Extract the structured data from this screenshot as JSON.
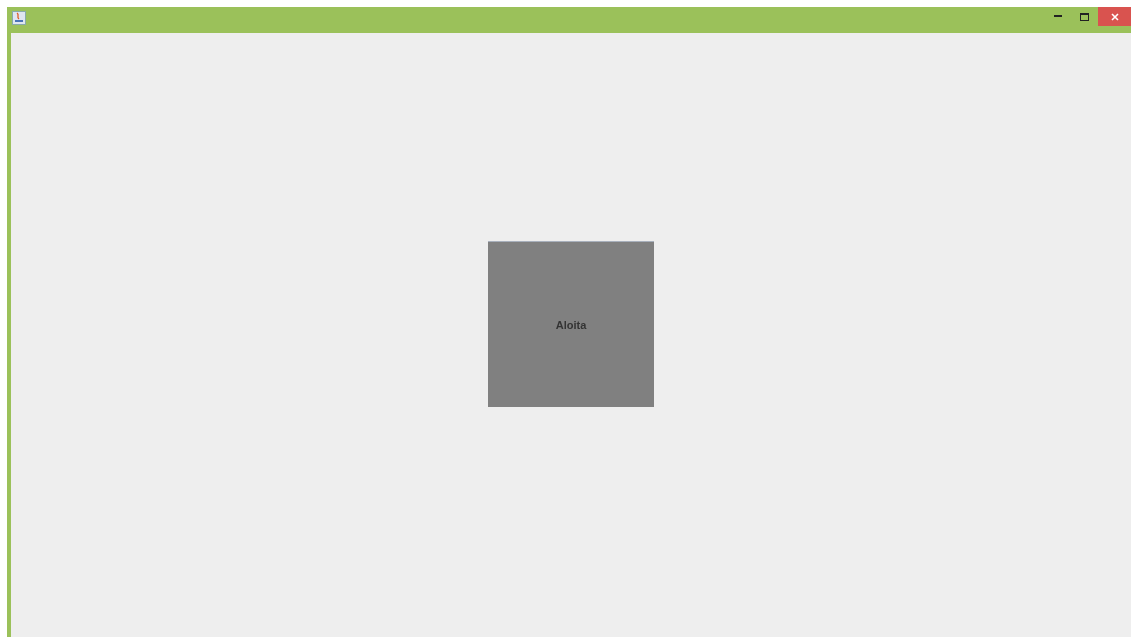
{
  "window": {
    "title_buttons": [
      {
        "kind": "minimize"
      },
      {
        "kind": "maximize"
      },
      {
        "kind": "close"
      }
    ]
  },
  "content": {
    "button": {
      "label": "Aloita"
    }
  }
}
